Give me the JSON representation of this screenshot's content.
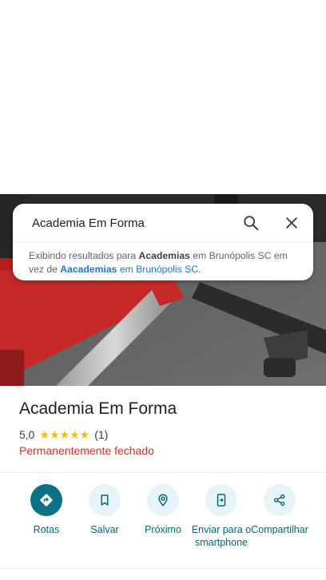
{
  "search": {
    "query": "Academia Em Forma",
    "notice_prefix": "Exibindo resultados para ",
    "notice_term": "Academias",
    "notice_middle": " em Brunópolis SC em vez de ",
    "notice_alt_term": "Aacademias",
    "notice_alt_suffix": " em Brunópolis SC",
    "notice_end": "."
  },
  "place": {
    "name": "Academia Em Forma",
    "rating": "5,0",
    "stars": "★★★★★",
    "reviews": "(1)",
    "status": "Permanentemente fechado"
  },
  "actions": [
    {
      "label": "Rotas",
      "icon": "directions-icon"
    },
    {
      "label": "Salvar",
      "icon": "bookmark-icon"
    },
    {
      "label": "Próximo",
      "icon": "nearby-icon"
    },
    {
      "label": "Enviar para o smartphone",
      "icon": "send-to-phone-icon"
    },
    {
      "label": "Compartilhar",
      "icon": "share-icon"
    }
  ],
  "colors": {
    "accent": "#0b7285",
    "closed": "#d93025",
    "star": "#fbbc04"
  }
}
